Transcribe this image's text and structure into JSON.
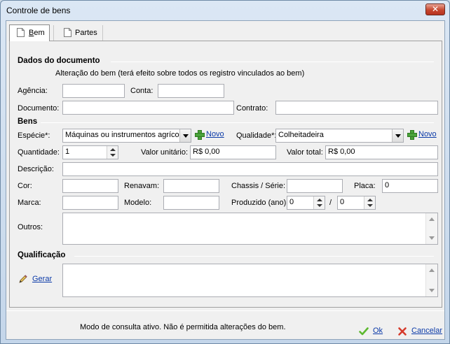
{
  "window": {
    "title": "Controle de bens",
    "close_glyph": "✕"
  },
  "tabs": [
    {
      "label_first": "B",
      "label_rest": "em",
      "icon": "document-icon"
    },
    {
      "label": "Partes",
      "icon": "document-icon"
    }
  ],
  "documento": {
    "heading": "Dados do documento",
    "note": "Alteração do bem (terá efeito sobre todos os registro vinculados ao bem)",
    "agencia_label": "Agência:",
    "agencia_value": "",
    "conta_label": "Conta:",
    "conta_value": "",
    "documento_label": "Documento:",
    "documento_value": "",
    "contrato_label": "Contrato:",
    "contrato_value": ""
  },
  "bens": {
    "heading": "Bens",
    "especie_label": "Espécie*:",
    "especie_value": "Máquinas ou instrumentos agrícolas",
    "novo_label": "Novo",
    "qualidade_label": "Qualidade*:",
    "qualidade_value": "Colheitadeira",
    "quantidade_label": "Quantidade:",
    "quantidade_value": "1",
    "valor_unitario_label": "Valor unitário:",
    "valor_unitario_value": "R$ 0,00",
    "valor_total_label": "Valor total:",
    "valor_total_value": "R$ 0,00",
    "descricao_label": "Descrição:",
    "descricao_value": "",
    "cor_label": "Cor:",
    "cor_value": "",
    "renavam_label": "Renavam:",
    "renavam_value": "",
    "chassis_label": "Chassis / Série:",
    "chassis_value": "",
    "placa_label": "Placa:",
    "placa_value": "0",
    "marca_label": "Marca:",
    "marca_value": "",
    "modelo_label": "Modelo:",
    "modelo_value": "",
    "produzido_label": "Produzido (ano):",
    "produzido_from": "0",
    "produzido_sep": "/",
    "produzido_to": "0",
    "outros_label": "Outros:"
  },
  "qualificacao": {
    "heading": "Qualificação",
    "gerar_label": "Gerar"
  },
  "footer": {
    "status": "Modo de consulta ativo. Não é permitida alterações do bem.",
    "ok_label": "Ok",
    "cancel_label": "Cancelar"
  },
  "colors": {
    "link": "#0b3aa8",
    "ok_icon": "#5cb82f",
    "cancel_icon": "#d63a2b",
    "add_icon": "#4aa33a"
  }
}
